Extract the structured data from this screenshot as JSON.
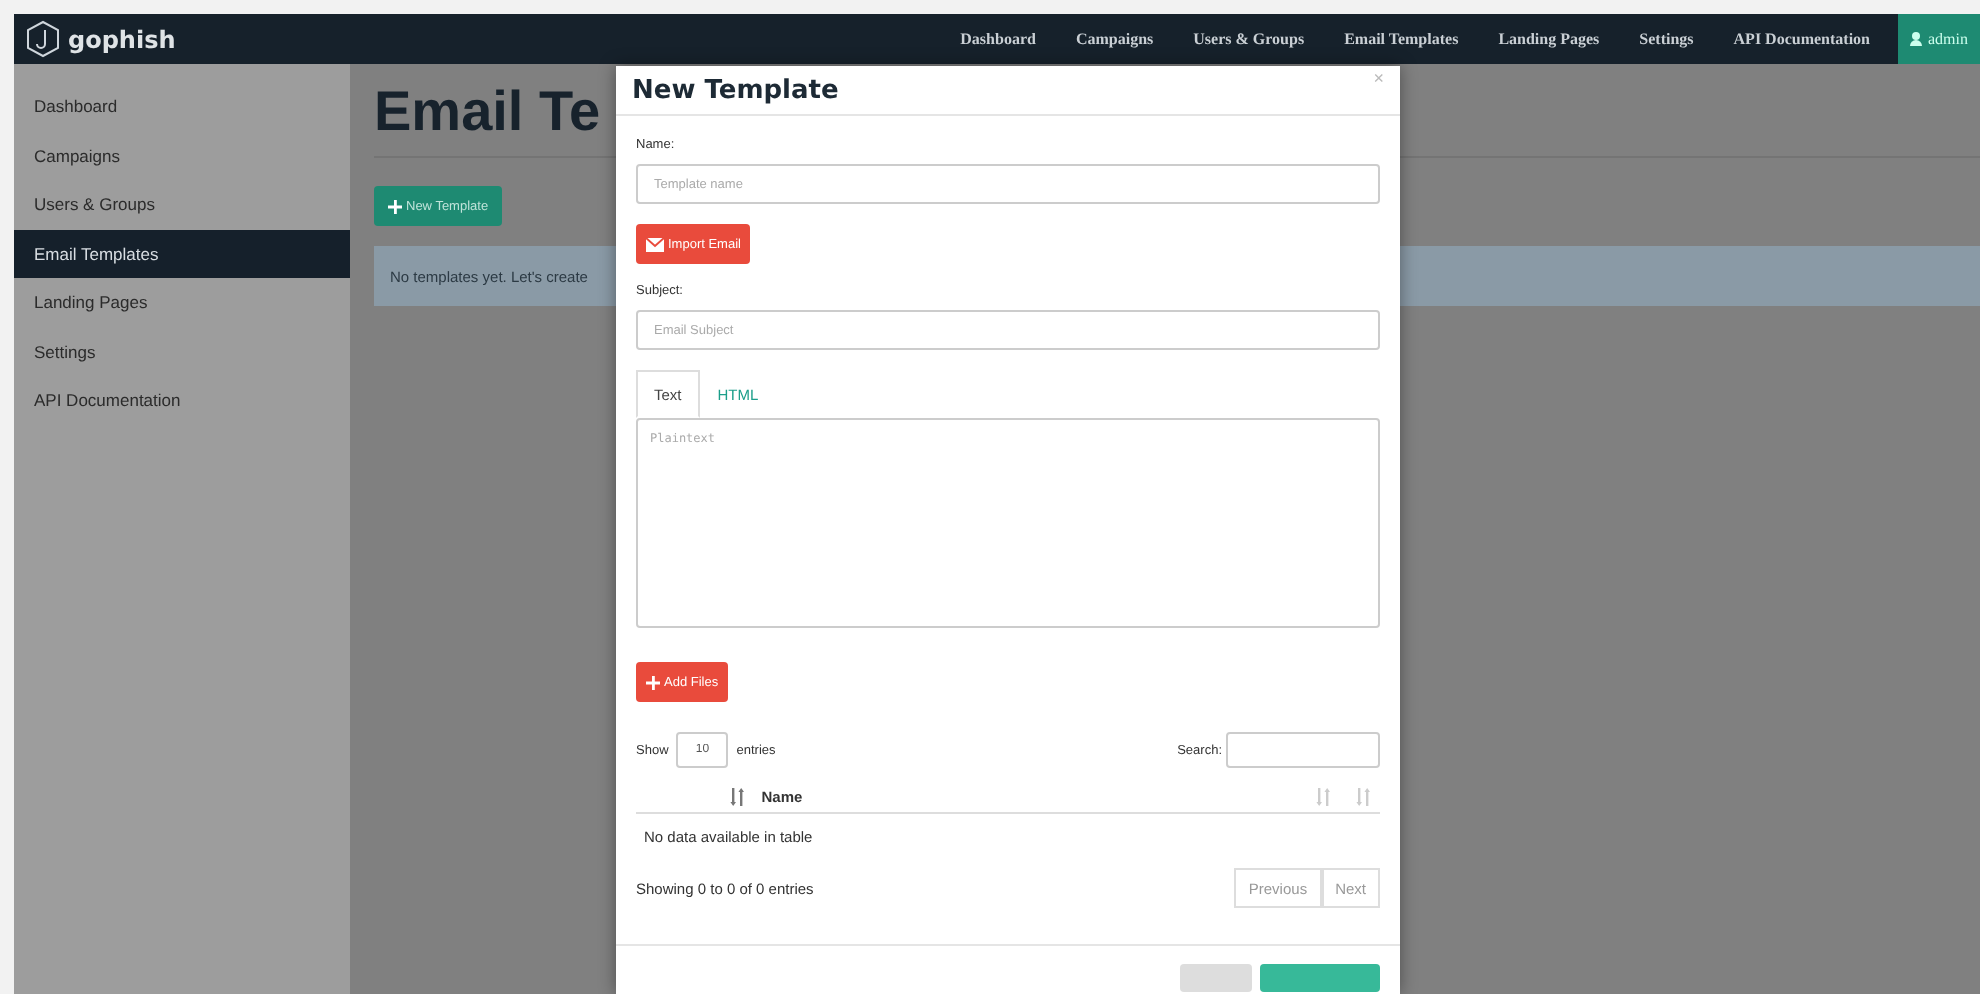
{
  "navbar": {
    "brand": "gophish",
    "links": [
      {
        "label": "Dashboard"
      },
      {
        "label": "Campaigns"
      },
      {
        "label": "Users & Groups"
      },
      {
        "label": "Email Templates"
      },
      {
        "label": "Landing Pages"
      },
      {
        "label": "Settings"
      },
      {
        "label": "API Documentation"
      }
    ],
    "user": "admin"
  },
  "sidebar": {
    "items": [
      {
        "label": "Dashboard",
        "selected": false
      },
      {
        "label": "Campaigns",
        "selected": false
      },
      {
        "label": "Users & Groups",
        "selected": false
      },
      {
        "label": "Email Templates",
        "selected": true
      },
      {
        "label": "Landing Pages",
        "selected": false
      },
      {
        "label": "Settings",
        "selected": false
      },
      {
        "label": "API Documentation",
        "selected": false
      }
    ]
  },
  "page": {
    "title": "Email Te",
    "new_button": "New Template",
    "notice": "No templates yet. Let's create"
  },
  "modal": {
    "title": "New Template",
    "close": "×",
    "name_field": {
      "label": "Name:",
      "placeholder": "Template name"
    },
    "import_button": "Import Email",
    "subject_field": {
      "label": "Subject:",
      "placeholder": "Email Subject"
    },
    "tabs": [
      {
        "label": "Text",
        "selected": true
      },
      {
        "label": "HTML",
        "selected": false
      }
    ],
    "editor": {
      "placeholder": "Plaintext"
    },
    "add_files_button": "Add Files",
    "attachments": {
      "show_label": "Show",
      "page_size": "10",
      "entries_label": "entries",
      "search_label": "Search:",
      "columns": [
        {
          "sorted": true
        },
        {
          "label": "Name",
          "sorted": false
        },
        {
          "sorted": false
        }
      ],
      "empty_text": "No data available in table",
      "info": "Showing 0 to 0 of 0 entries",
      "pagination": [
        {
          "label": "Previous",
          "disabled": true
        },
        {
          "label": "Next",
          "disabled": true
        }
      ]
    }
  }
}
